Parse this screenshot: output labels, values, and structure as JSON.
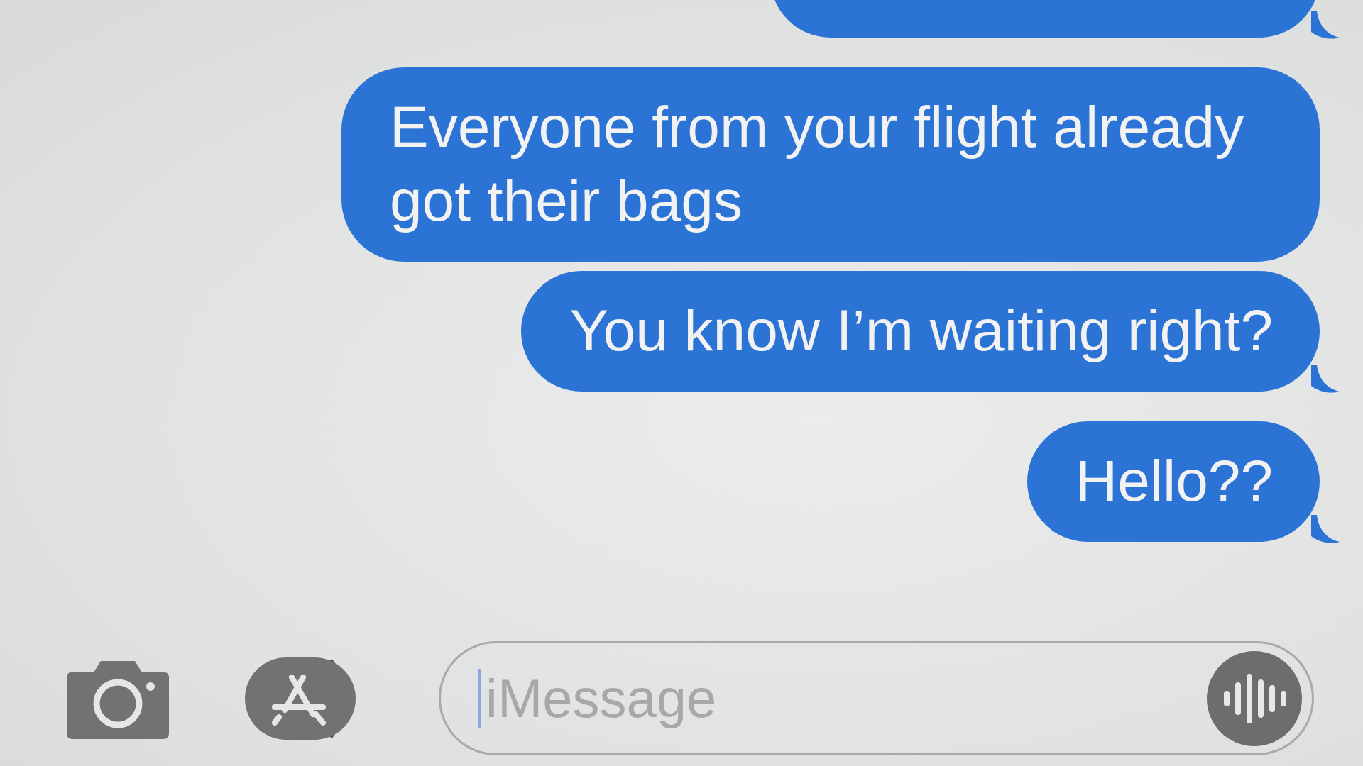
{
  "messages": [
    {
      "tail": true
    },
    {
      "text": "Everyone from your flight already got their bags",
      "tail": false
    },
    {
      "text": "You know I’m waiting right?",
      "tail": true
    },
    {
      "text": "Hello??",
      "tail": true
    }
  ],
  "composer": {
    "placeholder": "iMessage"
  }
}
